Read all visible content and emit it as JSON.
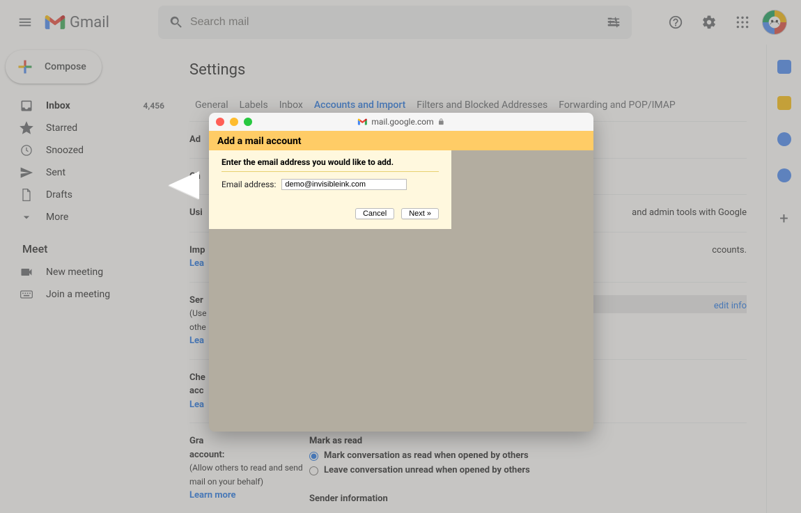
{
  "header": {
    "app_name": "Gmail",
    "search_placeholder": "Search mail"
  },
  "compose": {
    "label": "Compose"
  },
  "nav": {
    "items": [
      {
        "label": "Inbox",
        "count": "4,456",
        "active": true
      },
      {
        "label": "Starred"
      },
      {
        "label": "Snoozed"
      },
      {
        "label": "Sent"
      },
      {
        "label": "Drafts"
      },
      {
        "label": "More"
      }
    ]
  },
  "meet": {
    "title": "Meet",
    "items": [
      {
        "label": "New meeting"
      },
      {
        "label": "Join a meeting"
      }
    ]
  },
  "settings": {
    "title": "Settings",
    "tabs": [
      "General",
      "Labels",
      "Inbox",
      "Accounts and Import",
      "Filters and Blocked Addresses",
      "Forwarding and POP/IMAP"
    ],
    "active_tab": "Accounts and Import",
    "addons_tab_truncated": "Ad",
    "sections": {
      "change": {
        "label": "Ch"
      },
      "using_gsuite": {
        "label": "Usi",
        "body_tail": "and admin tools with Google"
      },
      "import": {
        "label": "Imp",
        "learn": "Lea",
        "body_tail": "ccounts."
      },
      "send_as": {
        "label": "Ser",
        "sub1": "(Use",
        "sub2": "othe",
        "learn": "Lea",
        "edit": "edit info"
      },
      "check_mail": {
        "label_line1": "Che",
        "label_line2": "acc",
        "learn": "Lea"
      },
      "grant": {
        "label_line1": "Gra",
        "label_line2": "account:",
        "sub1": "(Allow others to read and send",
        "sub2": "mail on your behalf)",
        "learn": "Learn more",
        "mark_as_read_heading": "Mark as read",
        "radio1": "Mark conversation as read when opened by others",
        "radio2": "Leave conversation unread when opened by others",
        "sender_info": "Sender information"
      }
    }
  },
  "popup": {
    "url": "mail.google.com",
    "title": "Add a mail account",
    "instruction": "Enter the email address you would like to add.",
    "email_label": "Email address:",
    "email_value": "demo@invisibleink.com",
    "cancel": "Cancel",
    "next": "Next »"
  }
}
